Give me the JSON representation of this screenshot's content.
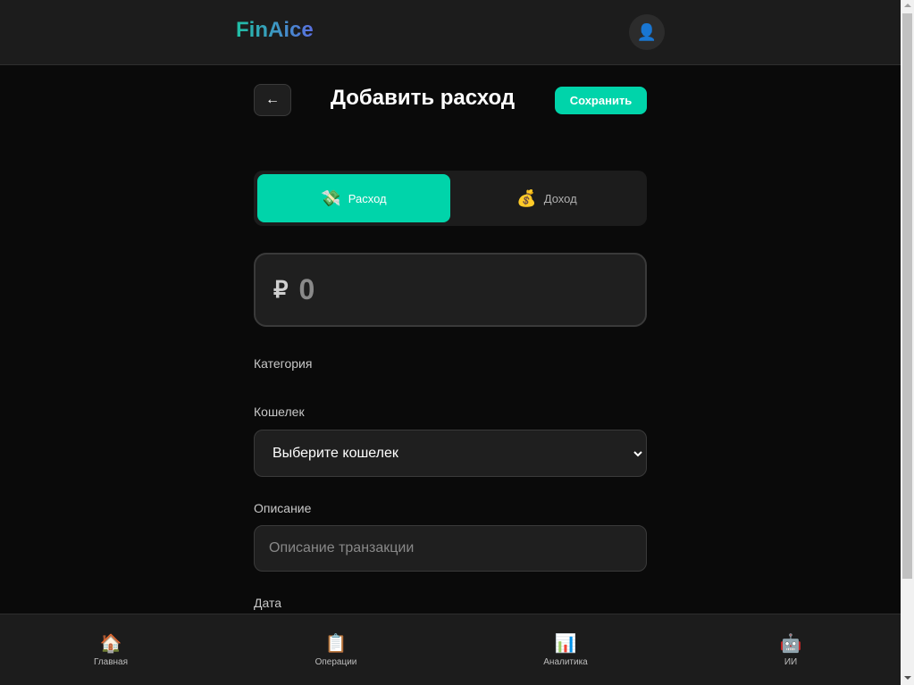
{
  "header": {
    "logo": "FinAice",
    "avatar_icon": "user-icon",
    "avatar_glyph": "👤"
  },
  "page": {
    "back_icon": "arrow-left-icon",
    "back_glyph": "←",
    "title": "Добавить расход",
    "save_label": "Сохранить"
  },
  "type_switch": {
    "options": [
      {
        "label": "Расход",
        "icon": "money-with-wings-icon",
        "glyph": "💸",
        "active": true
      },
      {
        "label": "Доход",
        "icon": "money-bag-icon",
        "glyph": "💰",
        "active": false
      }
    ]
  },
  "amount": {
    "currency": "₽",
    "placeholder": "0"
  },
  "form": {
    "category_label": "Категория",
    "wallet_label": "Кошелек",
    "wallet_selected": "Выберите кошелек",
    "description_label": "Описание",
    "description_placeholder": "Описание транзакции",
    "date_label": "Дата"
  },
  "bottom_nav": {
    "items": [
      {
        "label": "Главная",
        "icon": "home-icon",
        "glyph": "🏠"
      },
      {
        "label": "Операции",
        "icon": "clipboard-icon",
        "glyph": "📋"
      },
      {
        "label": "Аналитика",
        "icon": "bar-chart-icon",
        "glyph": "📊"
      },
      {
        "label": "ИИ",
        "icon": "robot-icon",
        "glyph": "🤖"
      }
    ]
  },
  "colors": {
    "accent": "#00d4aa",
    "background": "#0a0a0a",
    "surface": "#1c1c1c"
  }
}
